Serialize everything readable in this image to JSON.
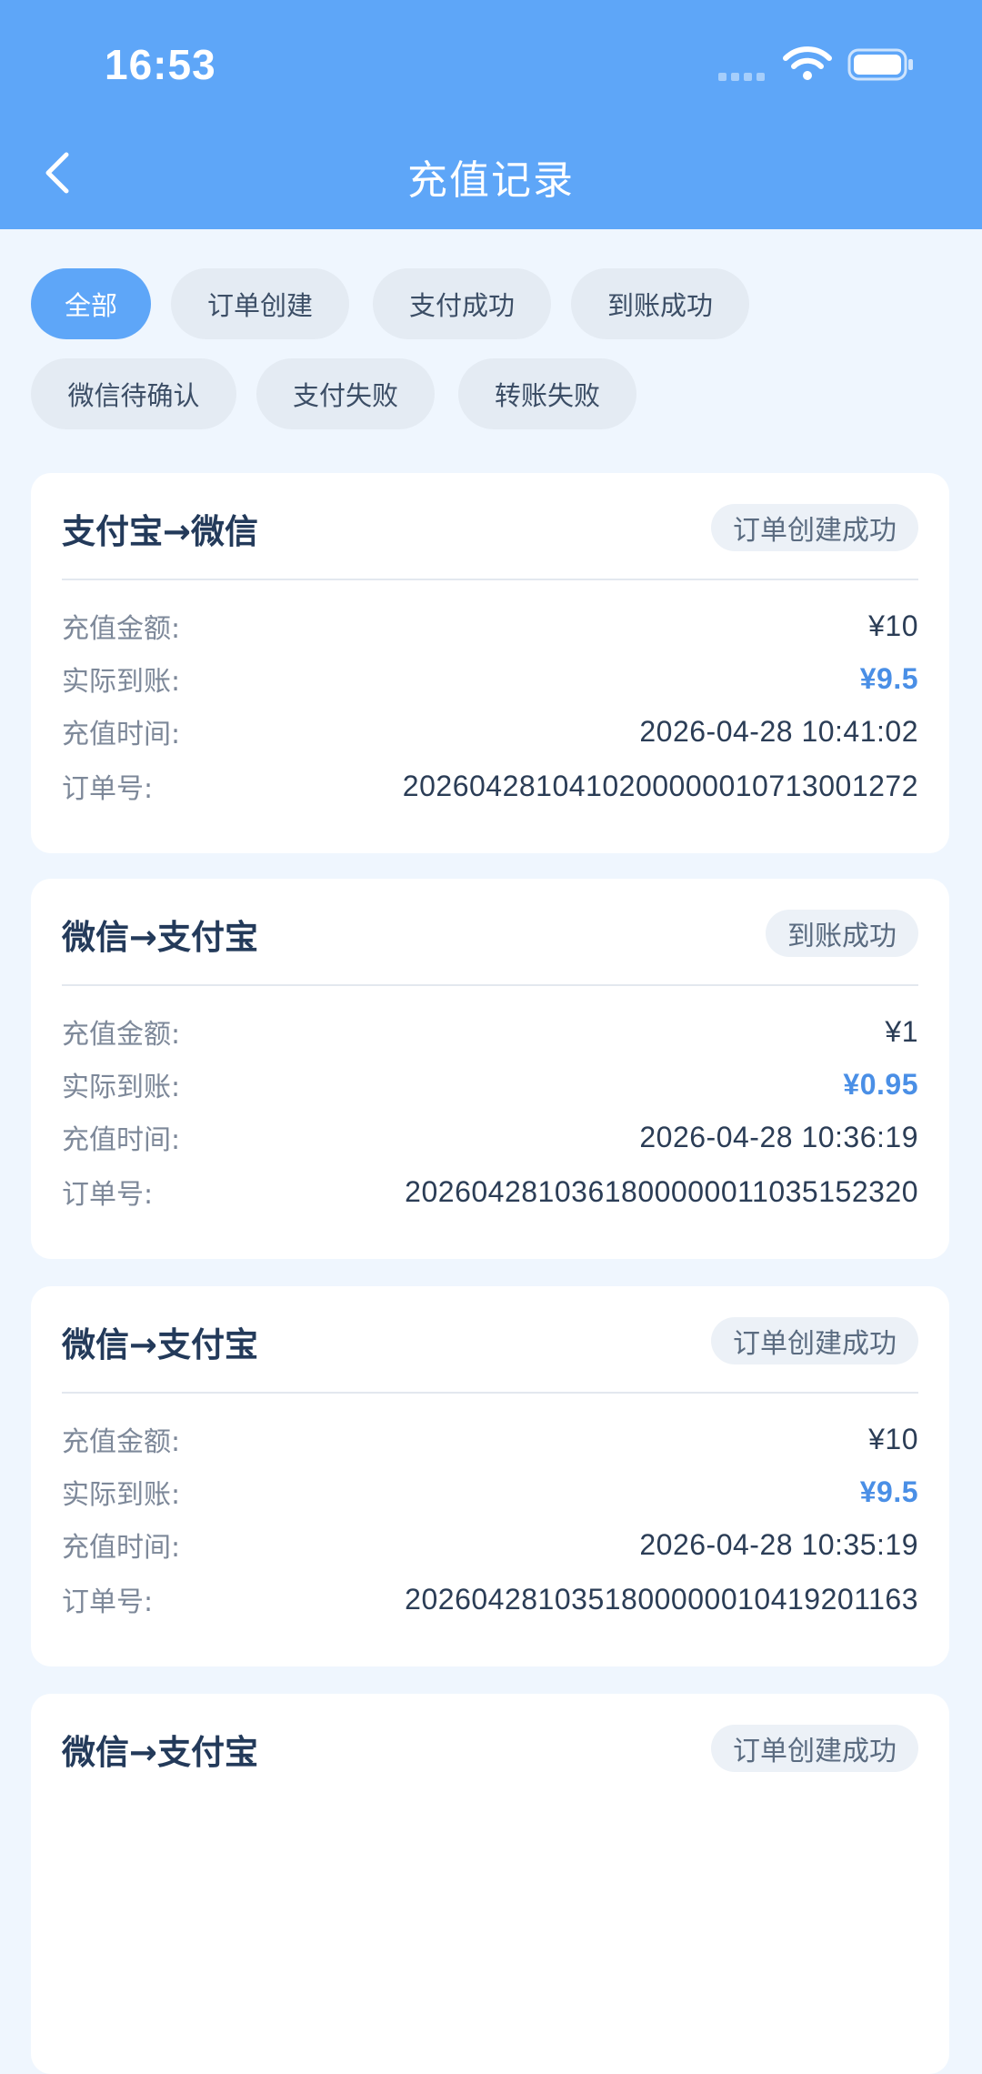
{
  "status_bar": {
    "time": "16:53"
  },
  "nav": {
    "title": "充值记录"
  },
  "filters": [
    {
      "label": "全部",
      "active": true
    },
    {
      "label": "订单创建",
      "active": false
    },
    {
      "label": "支付成功",
      "active": false
    },
    {
      "label": "到账成功",
      "active": false
    },
    {
      "label": "微信待确认",
      "active": false
    },
    {
      "label": "支付失败",
      "active": false
    },
    {
      "label": "转账失败",
      "active": false
    }
  ],
  "labels": {
    "amount": "充值金额:",
    "actual": "实际到账:",
    "time": "充值时间:",
    "order_no": "订单号:"
  },
  "records": [
    {
      "title": "支付宝→微信",
      "status": "订单创建成功",
      "amount": "¥10",
      "actual": "¥9.5",
      "time": "2026-04-28 10:41:02",
      "order_no": "2026042810410200000010713001272"
    },
    {
      "title": "微信→支付宝",
      "status": "到账成功",
      "amount": "¥1",
      "actual": "¥0.95",
      "time": "2026-04-28 10:36:19",
      "order_no": "2026042810361800000011035152320"
    },
    {
      "title": "微信→支付宝",
      "status": "订单创建成功",
      "amount": "¥10",
      "actual": "¥9.5",
      "time": "2026-04-28 10:35:19",
      "order_no": "2026042810351800000010419201163"
    },
    {
      "title": "微信→支付宝",
      "status": "订单创建成功"
    }
  ],
  "colors": {
    "header": "#5ea6f8",
    "page_bg": "#eff6fe",
    "accent_amount": "#4a8fe6",
    "card_title": "#233a5a"
  }
}
